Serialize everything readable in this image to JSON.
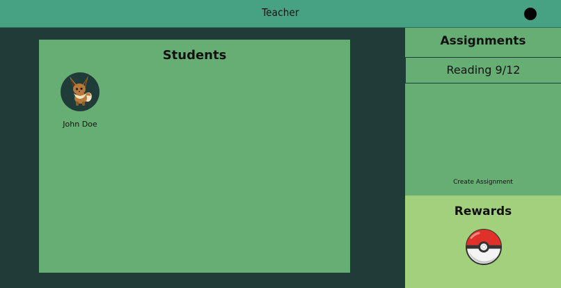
{
  "header": {
    "title": "Teacher"
  },
  "students": {
    "title": "Students",
    "items": [
      {
        "name": "John Doe",
        "avatar_icon": "eevee-icon"
      }
    ]
  },
  "assignments": {
    "title": "Assignments",
    "items": [
      {
        "label": "Reading 9/12"
      }
    ],
    "create_label": "Create Assignment"
  },
  "rewards": {
    "title": "Rewards",
    "items": [
      {
        "icon": "pokeball-icon"
      }
    ]
  },
  "colors": {
    "background": "#203c38",
    "header": "#47a283",
    "panel": "#66ae73",
    "rewards": "#a2d07c"
  }
}
